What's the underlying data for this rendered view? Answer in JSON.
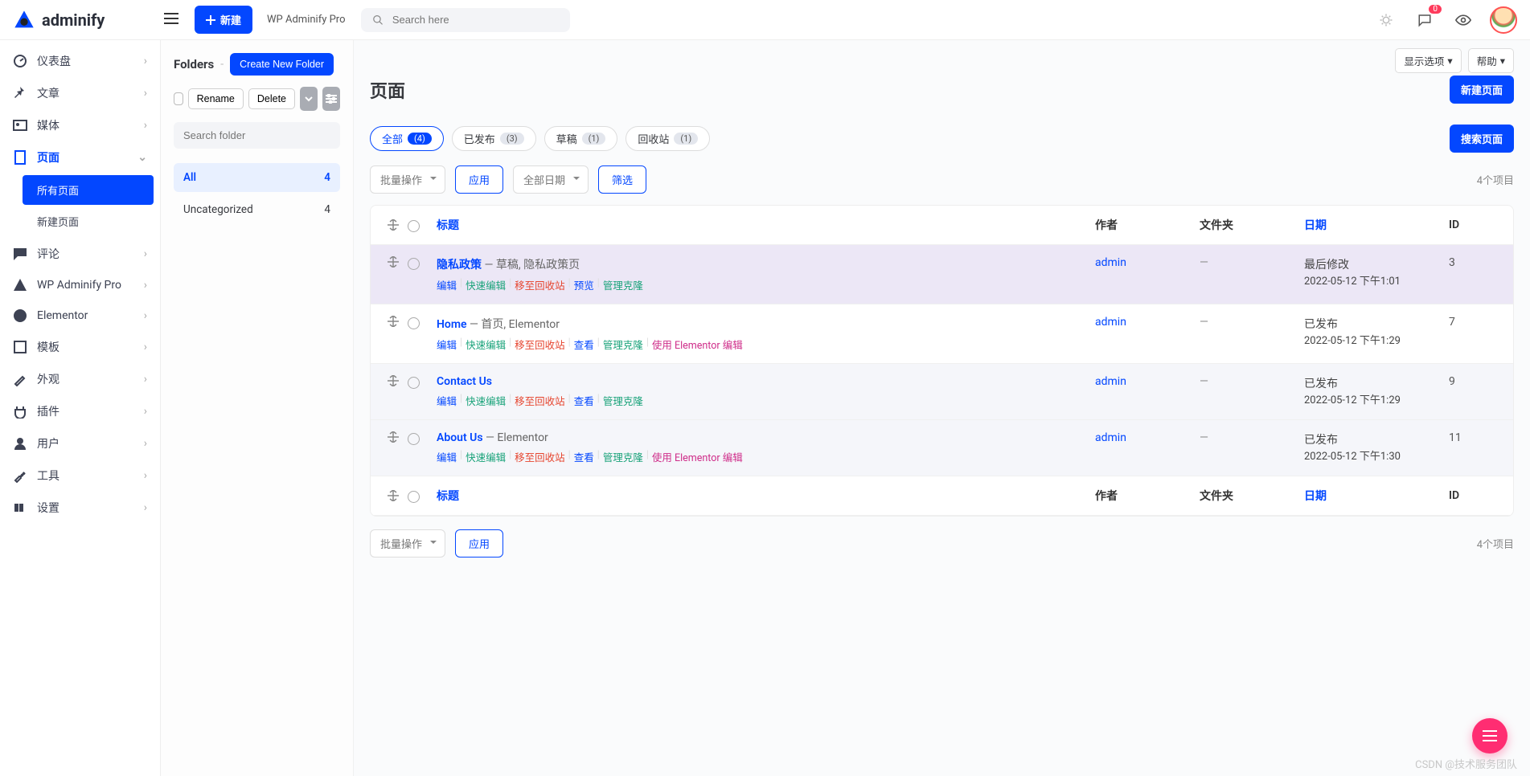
{
  "brand": "adminify",
  "topbar": {
    "new_btn": "新建",
    "product_link": "WP Adminify Pro",
    "search_placeholder": "Search here",
    "comments_badge": "0"
  },
  "sidebar": {
    "items": [
      {
        "label": "仪表盘",
        "icon": "gauge"
      },
      {
        "label": "文章",
        "icon": "pin"
      },
      {
        "label": "媒体",
        "icon": "media"
      },
      {
        "label": "页面",
        "icon": "page",
        "active": true,
        "sub": [
          {
            "label": "所有页面",
            "active": true
          },
          {
            "label": "新建页面"
          }
        ]
      },
      {
        "label": "评论",
        "icon": "comment"
      },
      {
        "label": "WP Adminify Pro",
        "icon": "adminify"
      },
      {
        "label": "Elementor",
        "icon": "elementor"
      },
      {
        "label": "模板",
        "icon": "template"
      },
      {
        "label": "外观",
        "icon": "brush"
      },
      {
        "label": "插件",
        "icon": "plugin"
      },
      {
        "label": "用户",
        "icon": "user"
      },
      {
        "label": "工具",
        "icon": "wrench"
      },
      {
        "label": "设置",
        "icon": "settings"
      }
    ]
  },
  "folders": {
    "title": "Folders",
    "create_btn": "Create New Folder",
    "rename_btn": "Rename",
    "delete_btn": "Delete",
    "search_placeholder": "Search folder",
    "items": [
      {
        "label": "All",
        "count": 4,
        "active": true
      },
      {
        "label": "Uncategorized",
        "count": 4
      }
    ]
  },
  "screen_options": {
    "display_opts": "显示选项",
    "help": "帮助"
  },
  "page": {
    "title": "页面",
    "new_page_btn": "新建页面"
  },
  "filter_tabs": [
    {
      "label": "全部",
      "count": "(4)",
      "active": true
    },
    {
      "label": "已发布",
      "count": "(3)"
    },
    {
      "label": "草稿",
      "count": "(1)"
    },
    {
      "label": "回收站",
      "count": "(1)"
    }
  ],
  "search_pages_btn": "搜索页面",
  "bulk": {
    "bulk_action": "批量操作",
    "apply": "应用",
    "all_dates": "全部日期",
    "filter": "筛选",
    "item_count": "4个项目"
  },
  "table": {
    "headers": {
      "title": "标题",
      "author": "作者",
      "folder": "文件夹",
      "date": "日期",
      "id": "ID"
    },
    "actions": {
      "edit": "编辑",
      "quick": "快速编辑",
      "trash": "移至回收站",
      "preview": "预览",
      "view": "查看",
      "clone": "管理克隆",
      "elementor": "使用 Elementor 编辑"
    },
    "rows": [
      {
        "title": "隐私政策",
        "meta": " — 草稿, 隐私政策页",
        "author": "admin",
        "folder": "—",
        "date_label": "最后修改",
        "date_value": "2022-05-12 下午1:01",
        "id": "3",
        "acts": [
          "edit",
          "quick",
          "trash",
          "preview",
          "clone"
        ]
      },
      {
        "title": "Home",
        "meta": " — 首页, Elementor",
        "author": "admin",
        "folder": "—",
        "date_label": "已发布",
        "date_value": "2022-05-12 下午1:29",
        "id": "7",
        "acts": [
          "edit",
          "quick",
          "trash",
          "view",
          "clone",
          "elementor"
        ]
      },
      {
        "title": "Contact Us",
        "meta": "",
        "author": "admin",
        "folder": "—",
        "date_label": "已发布",
        "date_value": "2022-05-12 下午1:29",
        "id": "9",
        "acts": [
          "edit",
          "quick",
          "trash",
          "view",
          "clone"
        ]
      },
      {
        "title": "About Us",
        "meta": " — Elementor",
        "author": "admin",
        "folder": "—",
        "date_label": "已发布",
        "date_value": "2022-05-12 下午1:30",
        "id": "11",
        "acts": [
          "edit",
          "quick",
          "trash",
          "view",
          "clone",
          "elementor"
        ]
      }
    ]
  },
  "watermark": "CSDN @技术服务团队"
}
